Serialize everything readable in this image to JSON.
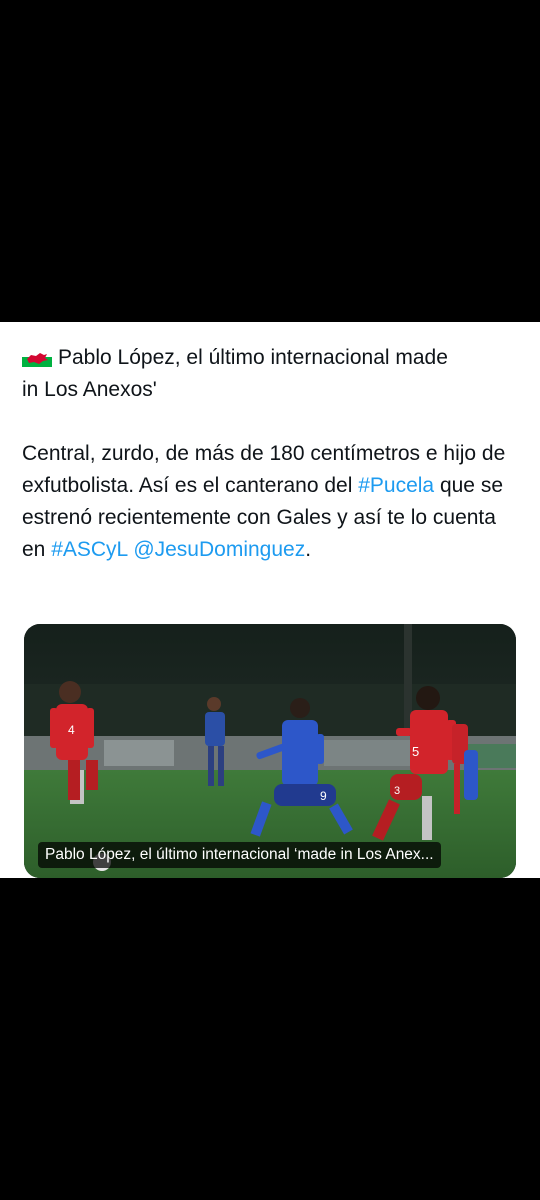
{
  "tweet": {
    "flag_icon": "wales-flag-icon",
    "headline_line1": "Pablo López, el último internacional made",
    "headline_line2": "in Los Anexos'",
    "body_part1": "Central, zurdo, de más de 180 centímetros e hijo de exfutbolista. Así es el canterano del ",
    "hashtag_pucela": "#Pucela",
    "body_part2": " que se estrenó recientemente con Gales y así te lo cuenta en ",
    "hashtag_ascyl": "#ASCyL",
    "mention": "@JesuDominguez",
    "body_end": ".",
    "link_color": "#1d9bf0"
  },
  "media": {
    "caption": "Pablo López, el último internacional ‘made in Los Anex...",
    "player_numbers": [
      "4",
      "9",
      "5",
      "3"
    ]
  }
}
